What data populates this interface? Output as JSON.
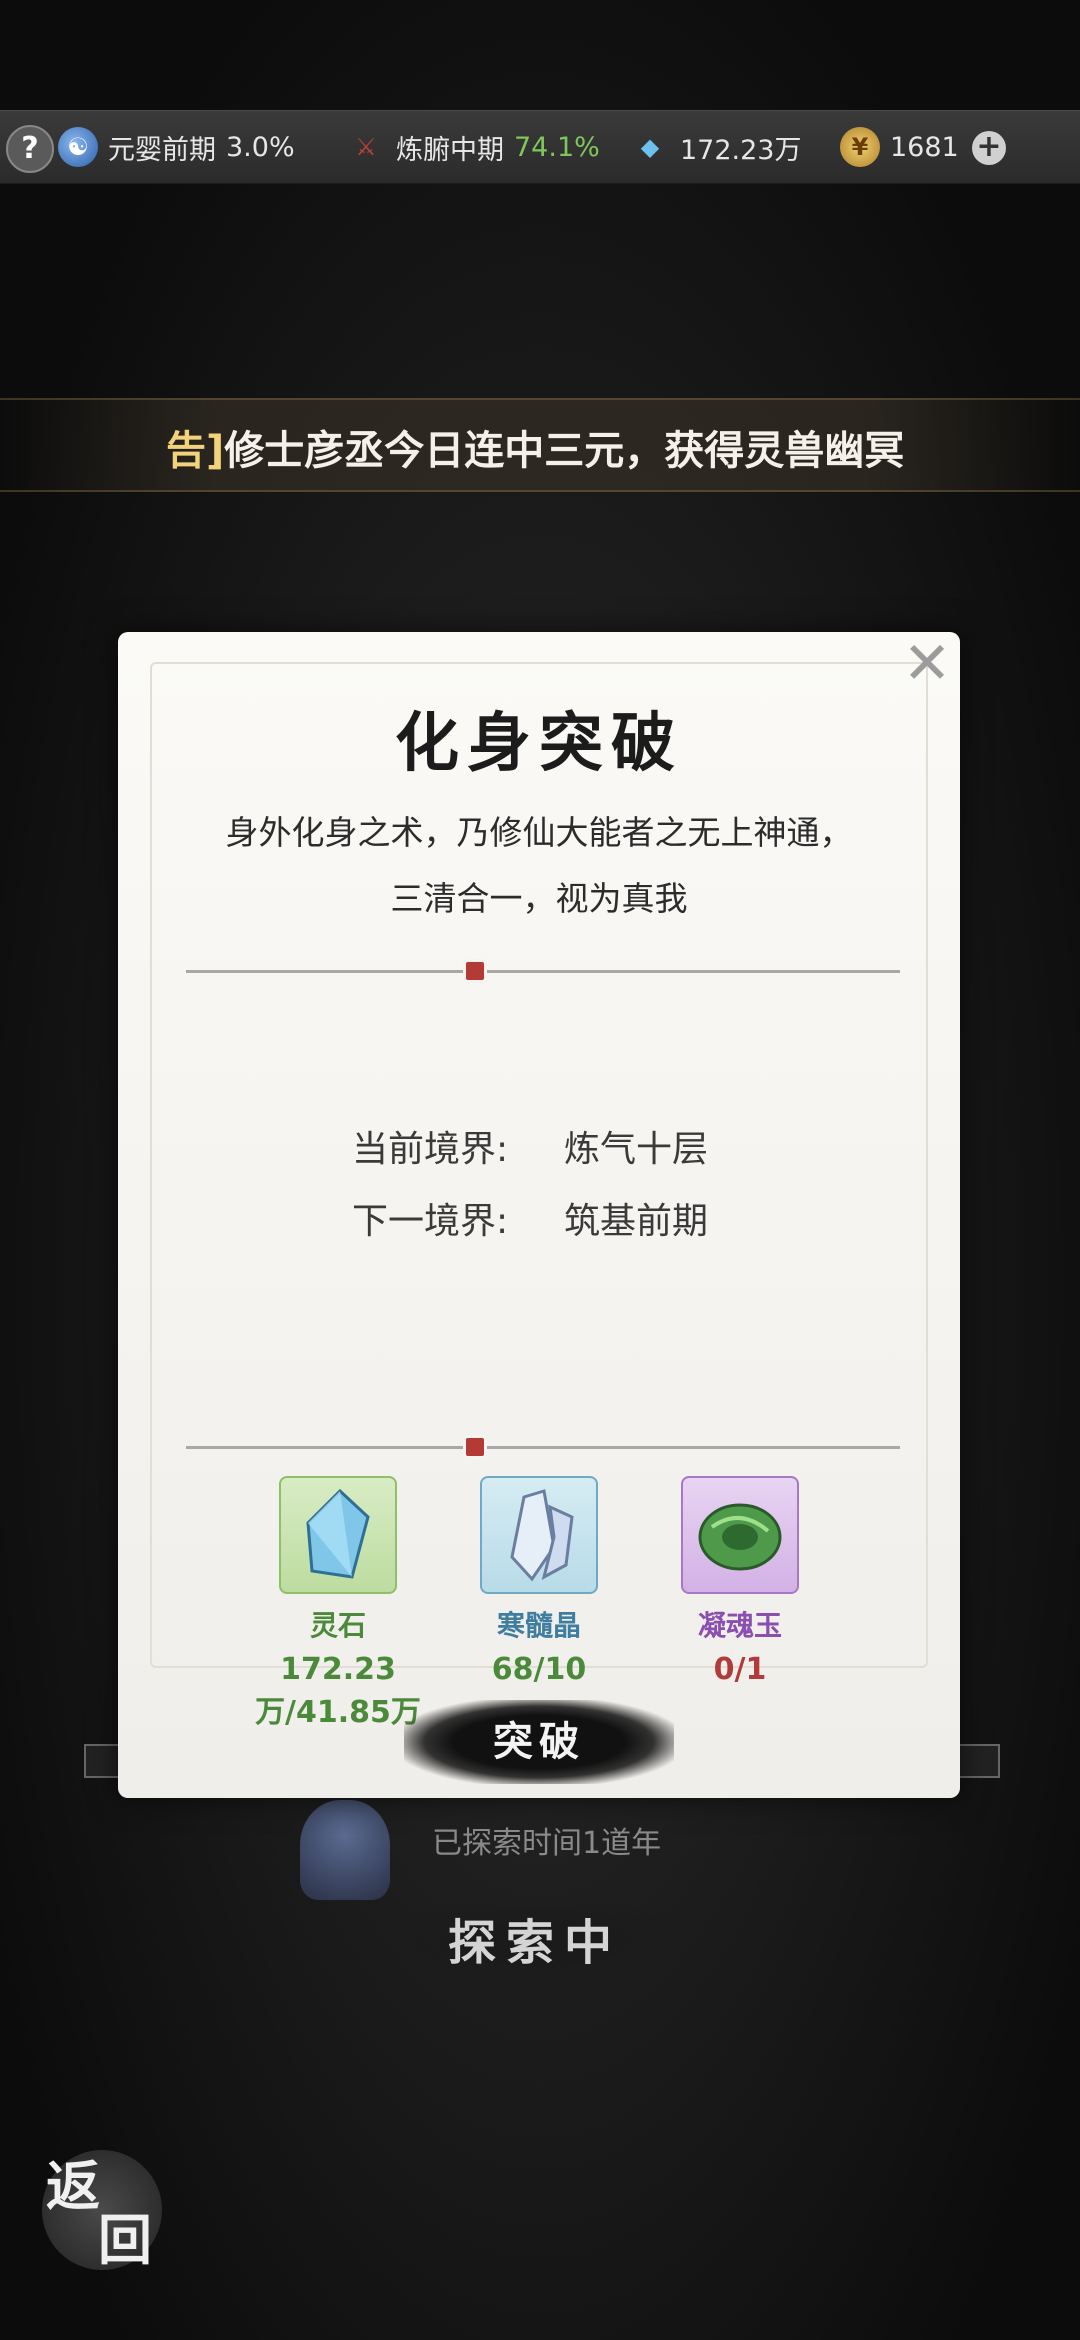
{
  "topbar": {
    "help": "?",
    "cultivation": {
      "realm": "元婴前期",
      "percent": "3.0%"
    },
    "body": {
      "realm": "炼腑中期",
      "percent": "74.1%"
    },
    "spirit_stones": "172.23万",
    "gold": "1681",
    "plus": "+"
  },
  "announcement": {
    "prefix": "告]",
    "text": "修士彦丞今日连中三元，获得灵兽幽冥"
  },
  "background": {
    "explore_time": "已探索时间1道年",
    "explore_button": "探索中",
    "back_1": "返",
    "back_2": "回"
  },
  "modal": {
    "title": "化身突破",
    "desc_line1": "身外化身之术，乃修仙大能者之无上神通，",
    "desc_line2": "三清合一，视为真我",
    "current_label": "当前境界:",
    "current_value": "炼气十层",
    "next_label": "下一境界:",
    "next_value": "筑基前期",
    "items": [
      {
        "name": "灵石",
        "count": "172.23万/41.85万",
        "icon": "spirit-stone-icon"
      },
      {
        "name": "寒髓晶",
        "count": "68/10",
        "icon": "ice-crystal-icon"
      },
      {
        "name": "凝魂玉",
        "count": "0/1",
        "icon": "soul-jade-icon"
      }
    ],
    "break_button": "突破",
    "close": "✕"
  },
  "colors": {
    "accent_green": "#7fc65b",
    "insufficient_red": "#b23a3a",
    "banner_gold": "#f3d27c"
  }
}
